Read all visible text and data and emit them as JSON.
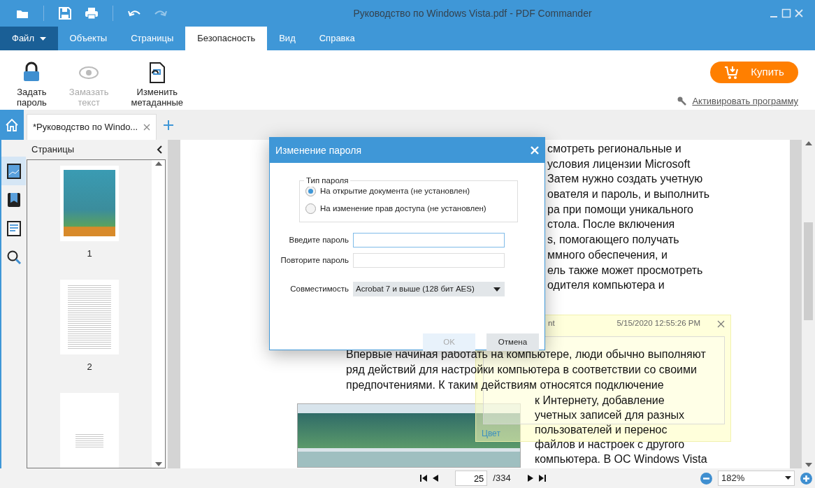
{
  "window": {
    "title": "Руководство по Windows Vista.pdf - PDF Commander"
  },
  "quick_access": [
    {
      "kind": "open",
      "disabled": false
    },
    {
      "kind": "save",
      "disabled": false
    },
    {
      "kind": "print",
      "disabled": false
    },
    {
      "kind": "undo",
      "disabled": false
    },
    {
      "kind": "redo",
      "disabled": true
    }
  ],
  "menu_tabs": [
    {
      "label": "Файл",
      "kind": "dropdown",
      "selected": false
    },
    {
      "label": "Объекты",
      "kind": "tab",
      "selected": false
    },
    {
      "label": "Страницы",
      "kind": "tab",
      "selected": false
    },
    {
      "label": "Безопасность",
      "kind": "tab",
      "selected": true
    },
    {
      "label": "Вид",
      "kind": "tab",
      "selected": false
    },
    {
      "label": "Справка",
      "kind": "tab",
      "selected": false
    }
  ],
  "ribbon": {
    "buttons": [
      {
        "label": "Задать\nпароль",
        "kind": "lock",
        "disabled": false
      },
      {
        "label": "Замазать\nтекст",
        "kind": "redact",
        "disabled": true
      },
      {
        "label": "Изменить\nметаданные",
        "kind": "metadata",
        "disabled": false
      }
    ],
    "buy_button": "Купить",
    "activate_link": "Активировать программу"
  },
  "document_tabs": [
    {
      "label": "*Руководство по Windo...",
      "selected": true
    }
  ],
  "side_rail": [
    {
      "kind": "pages",
      "selected": true
    },
    {
      "kind": "bookmarks",
      "selected": false
    },
    {
      "kind": "text",
      "selected": false
    },
    {
      "kind": "search",
      "selected": false
    }
  ],
  "pages_panel": {
    "title": "Страницы",
    "thumbnails": [
      {
        "label": "1",
        "kind": "cover"
      },
      {
        "label": "2",
        "kind": "text"
      },
      {
        "kind": "sparse"
      }
    ]
  },
  "document": {
    "top_lines": [
      "смотреть региональные и",
      "условия лицензии Microsoft",
      "Затем нужно создать учетную",
      "ователя и пароль, и выполнить",
      "ра при помощи уникального",
      "стола. После включения",
      "s, помогающего получать",
      "ммного обеспечения, и",
      "ель также может просмотреть",
      "одителя компьютера и"
    ],
    "paragraph": [
      "Впервые начиная работать на компьютере, люди обычно выполняют",
      "ряд действий для настройки компьютера в соответствии со своими",
      "предпочтениями. К таким действиям относятся подключение"
    ],
    "side_lines": [
      "к Интернету, добавление",
      "учетных записей для разных",
      "пользователей и перенос",
      "файлов и настроек с другого",
      "компьютера. В ОС Windows Vista"
    ]
  },
  "annotation": {
    "author": "nt",
    "date": "5/15/2020 12:55:26 PM",
    "color_label": "Цвет"
  },
  "dialog": {
    "title": "Изменение пароля",
    "group_title": "Тип пароля",
    "options": [
      {
        "label": "На открытие документа (не установлен)",
        "selected": true
      },
      {
        "label": "На изменение прав доступа (не установлен)",
        "selected": false
      }
    ],
    "fields": [
      {
        "label": "Введите пароль",
        "focused": true
      },
      {
        "label": "Повторите пароль",
        "focused": false
      }
    ],
    "compatibility": {
      "label": "Совместимость",
      "value": "Acrobat 7 и выше (128 бит AES)"
    },
    "buttons": [
      {
        "label": "OK",
        "disabled": true
      },
      {
        "label": "Отмена",
        "disabled": false
      }
    ]
  },
  "navigation": {
    "page": "25",
    "total": "/334",
    "zoom": "182%"
  }
}
